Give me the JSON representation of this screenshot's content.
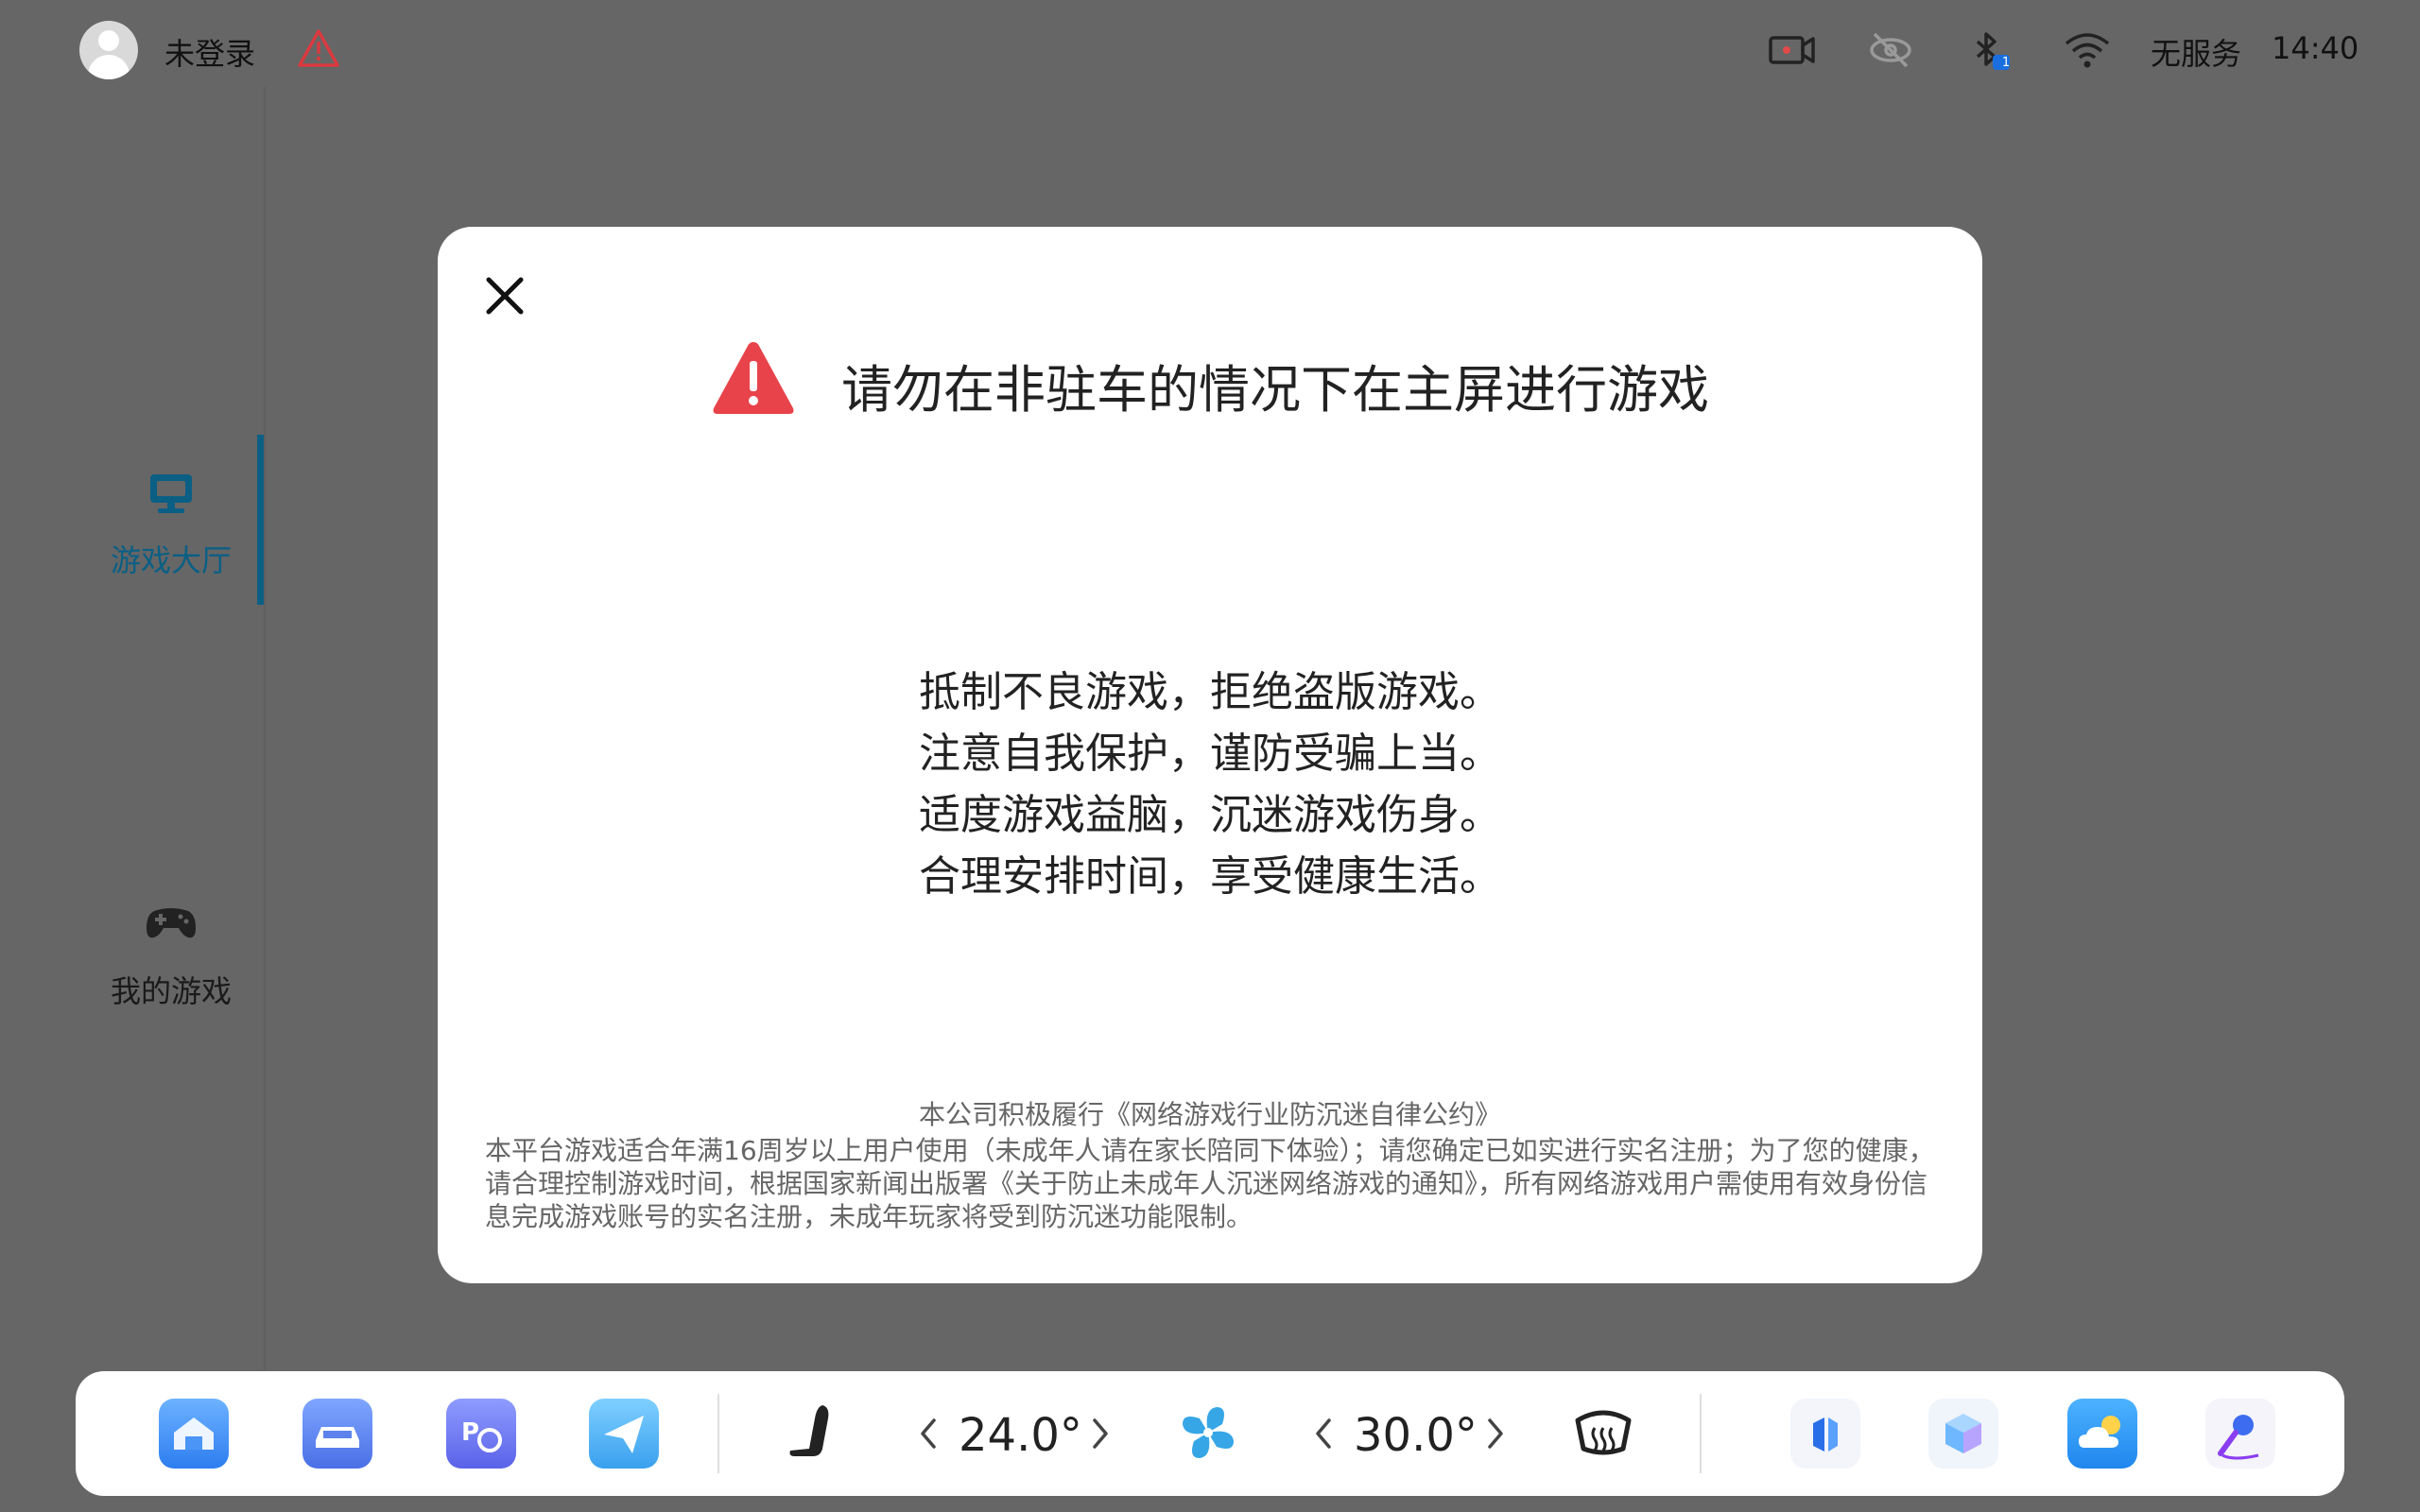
{
  "status_bar": {
    "login_status": "未登录",
    "network_status": "无服务",
    "time": "14:40",
    "bluetooth_badge": "1",
    "icons": [
      "avatar",
      "warning-icon",
      "dashcam-icon",
      "no-link-icon",
      "bluetooth-icon",
      "wifi-icon"
    ]
  },
  "sidebar": {
    "items": [
      {
        "label": "游戏大厅",
        "icon": "monitor-icon",
        "active": true
      },
      {
        "label": "我的游戏",
        "icon": "gamepad-icon",
        "active": false
      }
    ],
    "active_color": "#0b5f84"
  },
  "dialog": {
    "title": "请勿在非驻车的情况下在主屏进行游戏",
    "slogans": [
      "抵制不良游戏，拒绝盗版游戏。",
      "注意自我保护，谨防受骗上当。",
      "适度游戏益脑，沉迷游戏伤身。",
      "合理安排时间，享受健康生活。"
    ],
    "pledge": "本公司积极履行《网络游戏行业防沉迷自律公约》",
    "notice": "本平台游戏适合年满16周岁以上用户使用（未成年人请在家长陪同下体验）；请您确定已如实进行实名注册；为了您的健康，请合理控制游戏时间，根据国家新闻出版署《关于防止未成年人沉迷网络游戏的通知》，所有网络游戏用户需使用有效身份信息完成游戏账号的实名注册，未成年玩家将受到防沉迷功能限制。",
    "warning_color": "#e8434a"
  },
  "dock": {
    "left_apps": [
      "home-app-icon",
      "car-app-icon",
      "parking-app-icon",
      "navigation-app-icon"
    ],
    "driver_temp": "24.0°",
    "passenger_temp": "30.0°",
    "right_apps": [
      "store-app-icon",
      "cube-app-icon",
      "weather-app-icon",
      "voice-assistant-icon"
    ]
  }
}
